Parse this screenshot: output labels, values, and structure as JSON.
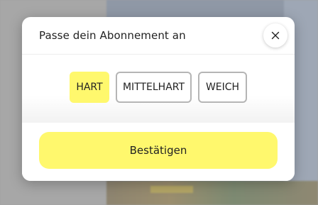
{
  "modal": {
    "title": "Passe dein Abonnement an",
    "close_icon": "close-icon",
    "options": [
      {
        "label": "HART",
        "selected": true
      },
      {
        "label": "MITTELHART",
        "selected": false
      },
      {
        "label": "WEICH",
        "selected": false
      }
    ],
    "confirm_label": "Bestätigen"
  },
  "colors": {
    "accent": "#fff86d",
    "unselected_border": "#b5b5b5",
    "text": "#222222"
  }
}
